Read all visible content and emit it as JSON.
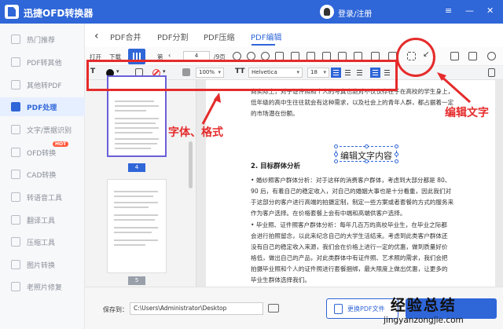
{
  "titlebar": {
    "app_title": "迅捷OFD转换器",
    "login": "登录/注册",
    "buttons": [
      "≡",
      "—",
      "✕"
    ]
  },
  "sidebar": {
    "items": [
      {
        "label": "热门推荐"
      },
      {
        "label": "PDF转其他"
      },
      {
        "label": "其他转PDF"
      },
      {
        "label": "PDF处理"
      },
      {
        "label": "文字/票据识别"
      },
      {
        "label": "OFD转换"
      },
      {
        "label": "CAD转换"
      },
      {
        "label": "转语音工具"
      },
      {
        "label": "翻译工具"
      },
      {
        "label": "压缩工具"
      },
      {
        "label": "图片转换"
      },
      {
        "label": "老照片修复"
      }
    ],
    "active_index": 3,
    "hot_badge": "HOT"
  },
  "tabs": {
    "back": "‹",
    "items": [
      "PDF合并",
      "PDF分割",
      "PDF压缩",
      "PDF编辑"
    ],
    "active_index": 3
  },
  "toolbar1": {
    "open": "打开",
    "download": "下载",
    "page_label": "第",
    "page_value": "4",
    "page_total": "/9页"
  },
  "toolbar2": {
    "text_icon": "T",
    "zoom": "100%",
    "font_icon": "TT",
    "font": "Helvetica",
    "size": "18"
  },
  "thumbnails": {
    "page_numbers": [
      "4",
      "5"
    ],
    "selected": "4"
  },
  "document": {
    "para1": [
      "商实际上，对于证件照和个人的写真也绝对不仅仅存在于在高校的学生身上，",
      "低年级的高中生往往就会有这种需求，以及社会上的青年人群，都占据着一定",
      "的市场潜在份额。"
    ],
    "heading": "2. 目标群体分析",
    "edit_text": "编辑文字内容",
    "para2": [
      "• 婚纱照客户群体分析：对于这样的消费客户群体，考虑到大部分都是 80、",
      "90 后，有着自己的稳定收入，对自己的婚姻大事也是十分看重，因此我们对",
      "于这部分的客户进行高端的拍摄定制，制定一些方案或者套餐的方式的服务来",
      "作为客户选择。在价格套餐上会有中端和高端供客户选择。"
    ],
    "para3": [
      "• 毕业照、证件照客户群体分析：每年几百万的高校毕业生，在毕业之际都",
      "会进行拍照留念，以此来纪念自己的大学生活结束。考虑到此类客户群体还",
      "没有自己的稳定收入来源，我们会在价格上进行一定的优惠，做到质量好价",
      "格低，做出自己的产品，对此类群体中有证件照、艺术照的需求，我们会把",
      "拍摄毕业照和个人的证件照进行套餐捆绑，最大限度上做出优惠，让更多的",
      "毕业生群体选择我们。"
    ]
  },
  "bottom": {
    "save_label": "保存到：",
    "path": "C:\\Users\\Administrator\\Desktop",
    "change": "更换PDF文件"
  },
  "annotations": {
    "edit_text": "编辑文字",
    "font_format": "字体、格式",
    "color": "#e52b2b"
  },
  "watermark": {
    "cn": "经验总结",
    "py": "jingyanzongjie.com"
  }
}
